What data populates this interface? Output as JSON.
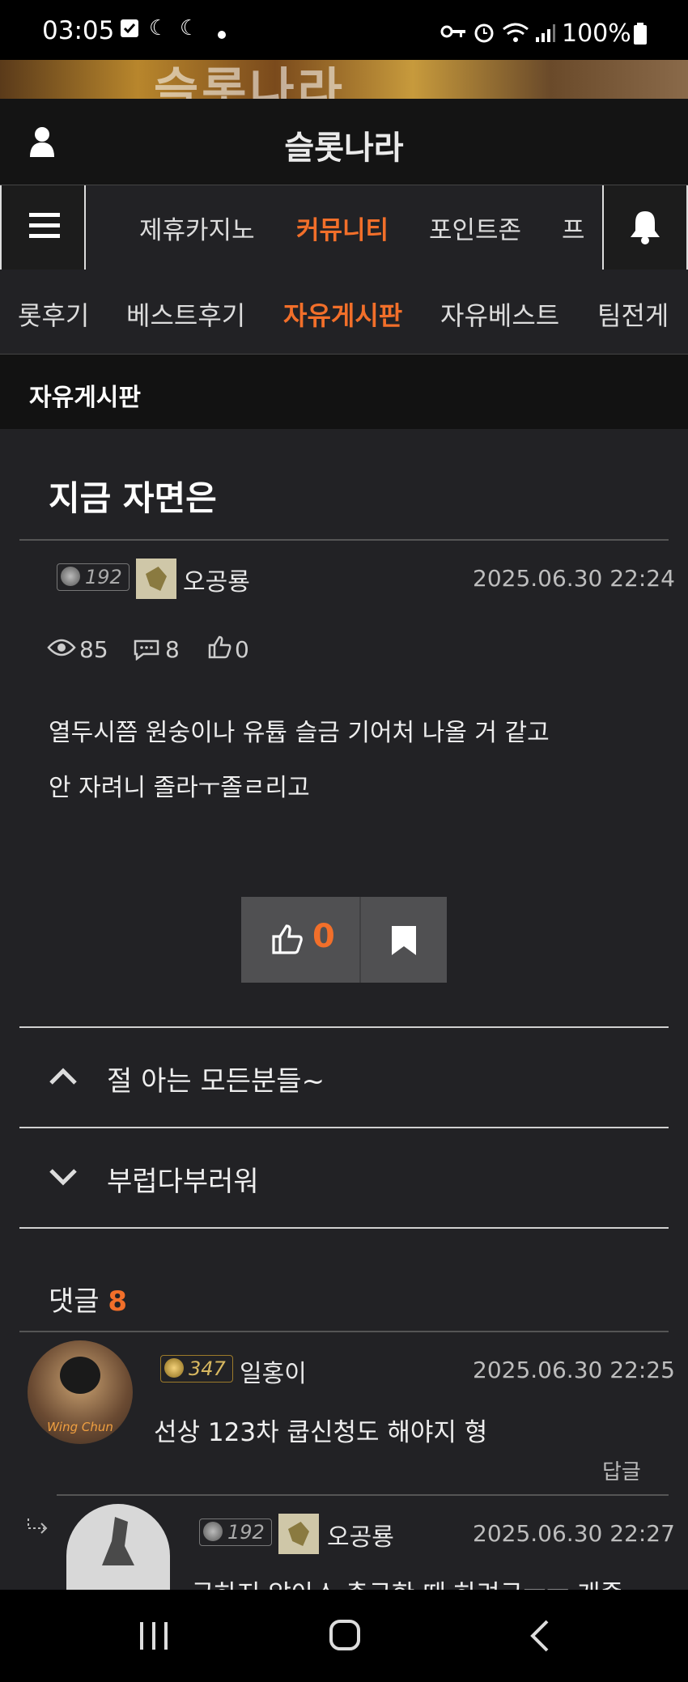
{
  "status_bar": {
    "time": "03:05",
    "battery": "100%"
  },
  "banner": {
    "text": "슬롯나라"
  },
  "header": {
    "title": "슬롯나라"
  },
  "nav_main": {
    "items": [
      "제휴카지노",
      "커뮤니티",
      "포인트존",
      "프"
    ],
    "active": "커뮤니티"
  },
  "nav_sub": {
    "items": [
      "롯후기",
      "베스트후기",
      "자유게시판",
      "자유베스트",
      "팀전게"
    ],
    "active": "자유게시판"
  },
  "board": {
    "label": "자유게시판"
  },
  "post": {
    "title": "지금 자면은",
    "author": {
      "level": "192",
      "name": "오공룡"
    },
    "date": "2025.06.30 22:24",
    "views": "85",
    "comments": "8",
    "likes": "0",
    "body": [
      "열두시쯤 원숭이나 유튭 슬금 기어처 나올 거 같고",
      "안 자려니 졸라ㅜ졸ㄹ리고"
    ],
    "like_button_count": "0"
  },
  "adjacent_posts": {
    "prev": "절 아는 모든분들~",
    "next": "부럽다부러워"
  },
  "comments_section": {
    "label": "댓글",
    "count": "8",
    "items": [
      {
        "level": "347",
        "name": "일홍이",
        "date": "2025.06.30 22:25",
        "text": "선상 123차 쿱신청도 해야지 형",
        "reply_label": "답글",
        "avatar_text": "Wing Chun"
      },
      {
        "level": "192",
        "name": "오공룡",
        "date": "2025.06.30 22:27",
        "text": "극하지 않아스 충구한 때 하려구ㅜㅜ 개좀"
      }
    ]
  },
  "colors": {
    "accent": "#f26f2a",
    "background": "#222225",
    "header_bg": "#141414"
  }
}
